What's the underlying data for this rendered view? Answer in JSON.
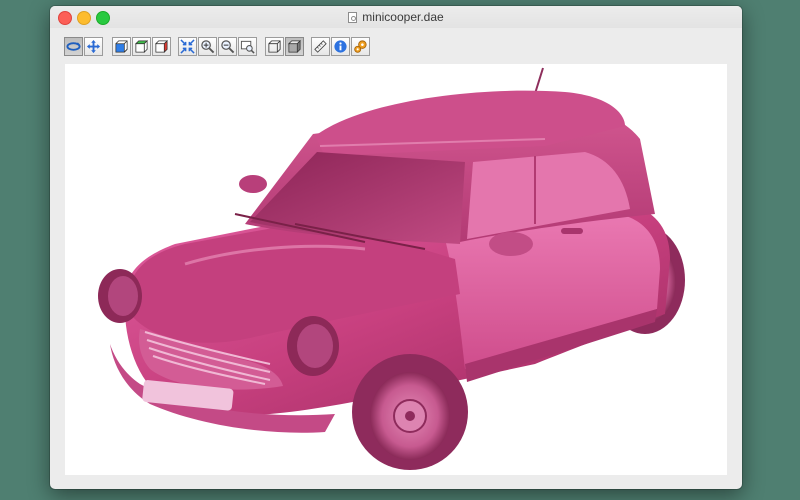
{
  "window": {
    "title": "minicooper.dae"
  },
  "toolbar": {
    "groups": [
      {
        "name": "navigation",
        "buttons": [
          {
            "icon": "orbit-icon",
            "pressed": true
          },
          {
            "icon": "pan-icon",
            "pressed": false
          }
        ]
      },
      {
        "name": "view-presets",
        "buttons": [
          {
            "icon": "cube-blue-icon",
            "pressed": false
          },
          {
            "icon": "cube-green-icon",
            "pressed": false
          },
          {
            "icon": "cube-red-icon",
            "pressed": false
          }
        ]
      },
      {
        "name": "zoom",
        "buttons": [
          {
            "icon": "zoom-fit-icon",
            "pressed": false
          },
          {
            "icon": "zoom-in-icon",
            "pressed": false
          },
          {
            "icon": "zoom-out-icon",
            "pressed": false
          },
          {
            "icon": "zoom-window-icon",
            "pressed": false
          }
        ]
      },
      {
        "name": "render-mode",
        "buttons": [
          {
            "icon": "wireframe-cube-icon",
            "pressed": false
          },
          {
            "icon": "shaded-cube-icon",
            "pressed": true
          }
        ]
      },
      {
        "name": "tools",
        "buttons": [
          {
            "icon": "ruler-icon",
            "pressed": false
          },
          {
            "icon": "info-icon",
            "pressed": false
          },
          {
            "icon": "settings-gears-icon",
            "pressed": false
          }
        ]
      }
    ]
  },
  "viewport": {
    "background": "#ffffff",
    "model_color": "#d0478a"
  }
}
